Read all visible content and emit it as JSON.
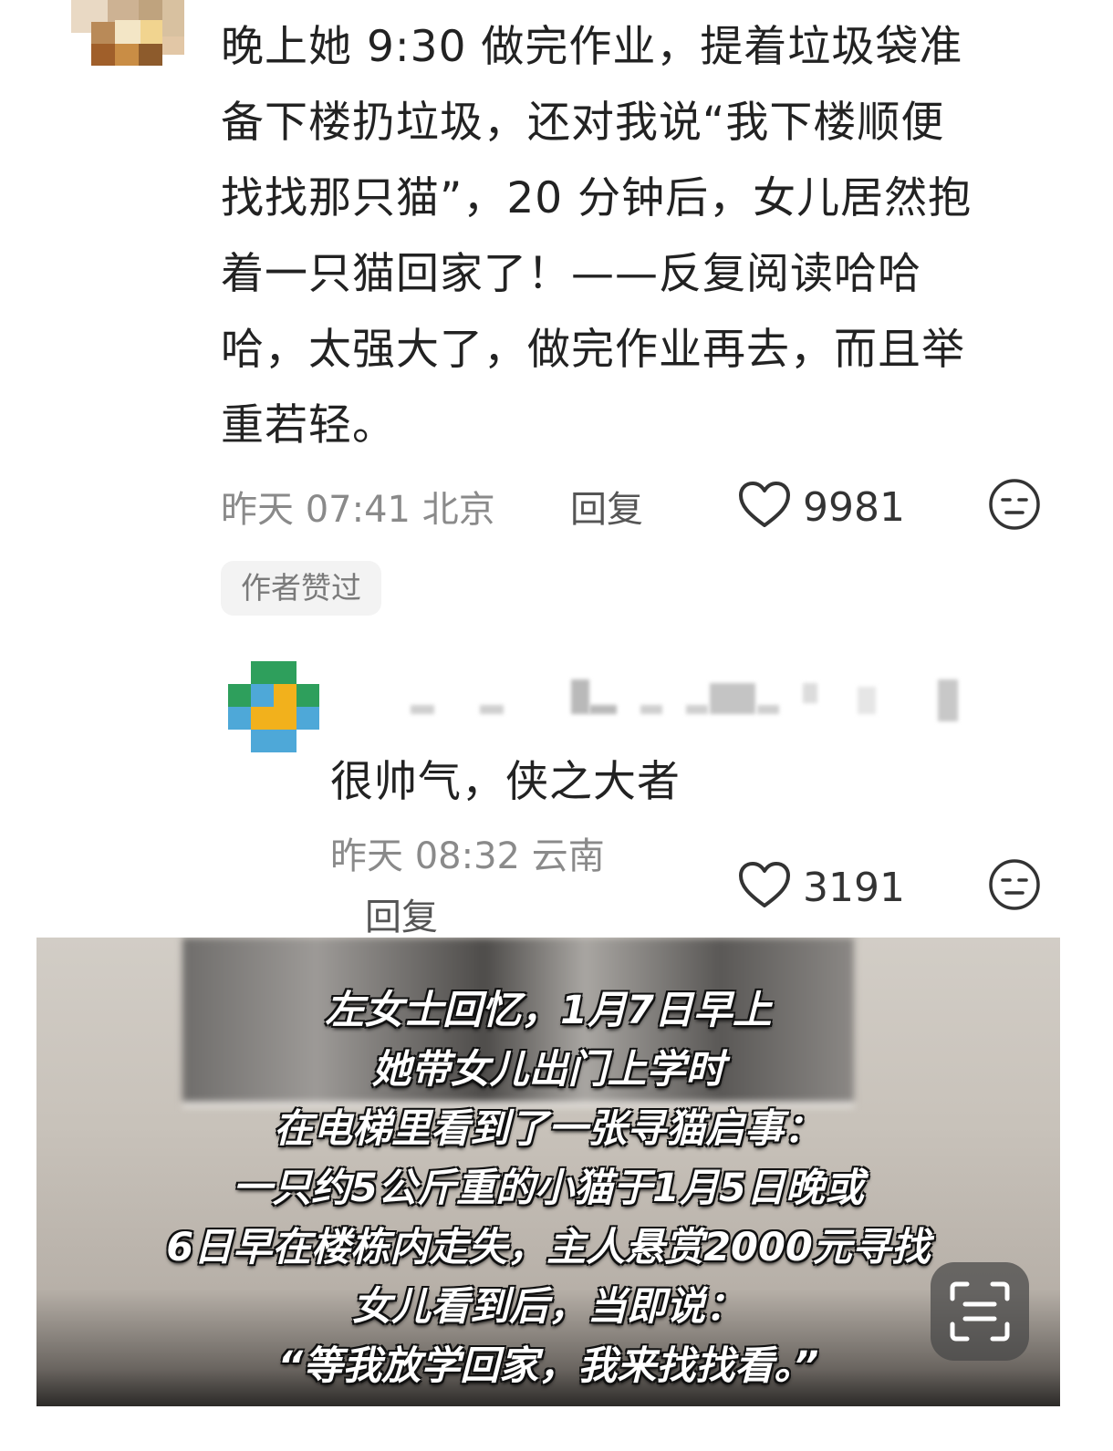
{
  "comment": {
    "lines": [
      "晚上她 9:30 做完作业，提着垃圾袋准",
      "备下楼扔垃圾，还对我说“我下楼顺便",
      "找找那只猫”，20 分钟后，女儿居然抱",
      "着一只猫回家了！——反复阅读哈哈",
      "哈，太强大了，做完作业再去，而且举",
      "重若轻。"
    ],
    "time": "昨天 07:41 北京",
    "reply_label": "回复",
    "likes": "9981",
    "author_badge": "作者赞过"
  },
  "reply": {
    "text": "很帅气，侠之大者",
    "time": "昨天 08:32 云南",
    "reply_label": "回复",
    "likes": "3191"
  },
  "video": {
    "subtitles": [
      "左女士回忆，1月7日早上",
      "她带女儿出门上学时",
      "在电梯里看到了一张寻猫启事：",
      "一只约5公斤重的小猫于1月5日晚或",
      "6日早在楼栋内走失，主人悬赏2000元寻找",
      "女儿看到后，当即说：",
      "“等我放学回家，我来找找看。”"
    ]
  },
  "icons": {
    "like": "heart-outline-icon",
    "emoji": "expressionless-face-icon",
    "scan": "scan-text-icon"
  }
}
